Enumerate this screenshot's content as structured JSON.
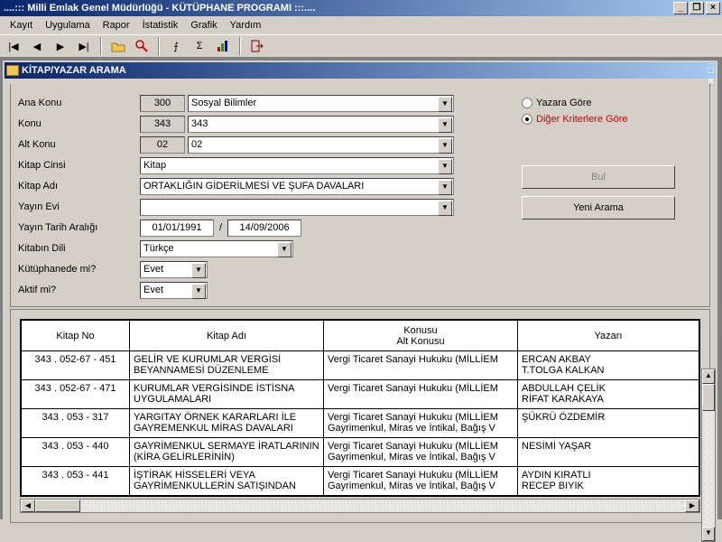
{
  "window": {
    "title": "....::: Milli Emlak Genel Müdürlüğü - KÜTÜPHANE PROGRAMI :::...."
  },
  "menu": [
    "Kayıt",
    "Uygulama",
    "Rapor",
    "İstatistik",
    "Grafik",
    "Yardım"
  ],
  "subwindow": {
    "title": "KİTAP/YAZAR ARAMA"
  },
  "form": {
    "anaKonu": {
      "label": "Ana Konu",
      "code": "300",
      "text": "Sosyal Bilimler"
    },
    "konu": {
      "label": "Konu",
      "code": "343",
      "text": "343"
    },
    "altKonu": {
      "label": "Alt Konu",
      "code": "02",
      "text": "02"
    },
    "kitapCinsi": {
      "label": "Kitap Cinsi",
      "text": "Kitap"
    },
    "kitapAdi": {
      "label": "Kitap Adı",
      "text": "ORTAKLIĞIN GİDERİLMESİ VE ŞUFA DAVALARI"
    },
    "yayinEvi": {
      "label": "Yayın Evi",
      "text": ""
    },
    "yayinTarih": {
      "label": "Yayın Tarih Aralığı",
      "from": "01/01/1991",
      "sep": "/",
      "to": "14/09/2006"
    },
    "kitabinDili": {
      "label": "Kitabın Dili",
      "text": "Türkçe"
    },
    "kutuphanede": {
      "label": "Kütüphanede mi?",
      "text": "Evet"
    },
    "aktif": {
      "label": "Aktif mi?",
      "text": "Evet"
    }
  },
  "radios": {
    "r1": "Yazara Göre",
    "r2": "Diğer Kriterlere Göre"
  },
  "buttons": {
    "bul": "Bul",
    "yeni": "Yeni Arama"
  },
  "table": {
    "headers": {
      "no": "Kitap No",
      "adi": "Kitap Adı",
      "konu": "Konusu",
      "altkonu": "Alt Konusu",
      "yazar": "Yazarı"
    },
    "rows": [
      {
        "no": "343 . 052-67 - 451",
        "adi": "GELİR VE KURUMLAR VERGİSİ BEYANNAMESİ DÜZENLEME",
        "konu": "Vergi Ticaret Sanayi Hukuku (MİLLİEM",
        "yazar": "ERCAN AKBAY\nT.TOLGA KALKAN"
      },
      {
        "no": "343 . 052-67 - 471",
        "adi": "KURUMLAR VERGİSİNDE İSTİSNA UYGULAMALARI",
        "konu": "Vergi Ticaret Sanayi Hukuku (MİLLİEM",
        "yazar": "ABDULLAH ÇELİK\nRİFAT KARAKAYA"
      },
      {
        "no": "343 . 053 - 317",
        "adi": "YARGITAY ÖRNEK KARARLARI İLE GAYREMENKUL MİRAS DAVALARI",
        "konu": "Vergi Ticaret Sanayi Hukuku (MİLLİEM Gayrimenkul, Miras ve İntikal, Bağış V",
        "yazar": "ŞÜKRÜ ÖZDEMİR"
      },
      {
        "no": "343 . 053 - 440",
        "adi": "GAYRİMENKUL SERMAYE İRATLARININ (KİRA GELİRLERİNİN)",
        "konu": "Vergi Ticaret Sanayi Hukuku (MİLLİEM Gayrimenkul, Miras ve İntikal, Bağış V",
        "yazar": "NESİMİ YAŞAR"
      },
      {
        "no": "343 . 053 - 441",
        "adi": "İŞTİRAK HİSSELERİ VEYA GAYRİMENKULLERİN SATIŞINDAN",
        "konu": "Vergi Ticaret Sanayi Hukuku (MİLLİEM Gayrimenkul, Miras ve İntikal, Bağış V",
        "yazar": "AYDIN KIRATLI\nRECEP BIYIK"
      }
    ]
  }
}
